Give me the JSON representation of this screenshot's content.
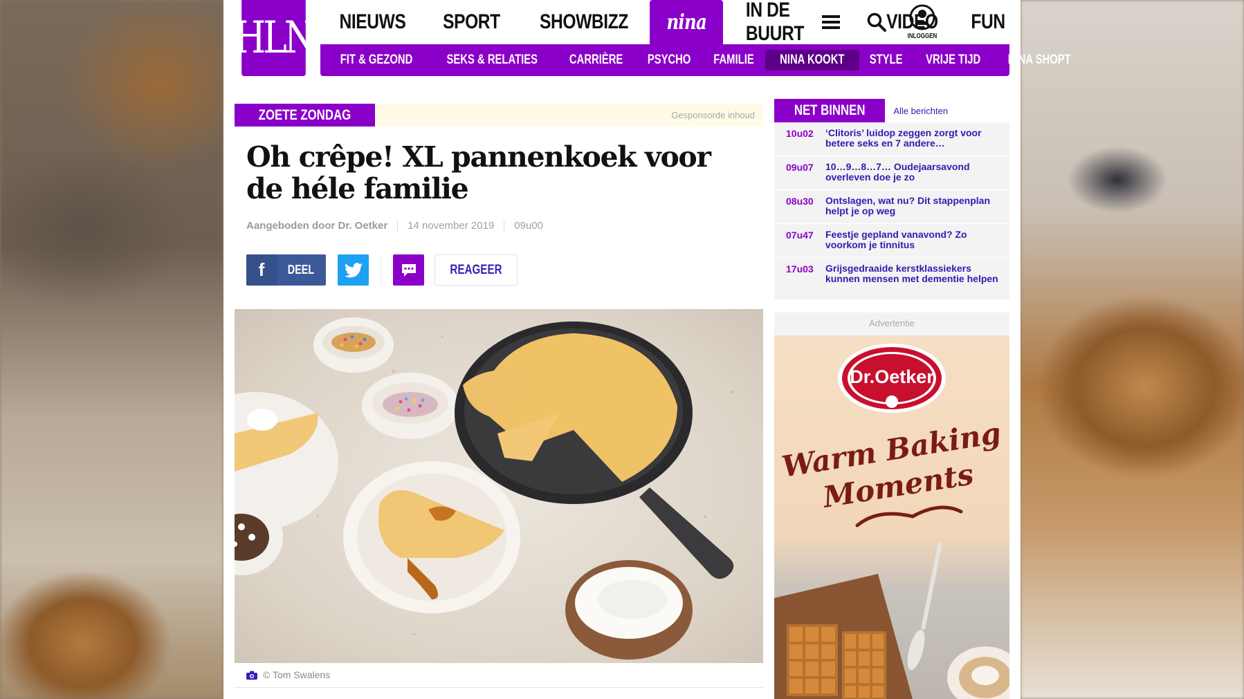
{
  "header": {
    "logo": "HLN",
    "main_nav": [
      {
        "label": "NIEUWS"
      },
      {
        "label": "SPORT"
      },
      {
        "label": "SHOWBIZZ"
      },
      {
        "label": "nina",
        "active": true
      },
      {
        "label": "IN DE BUURT"
      },
      {
        "label": "VIDEO"
      },
      {
        "label": "FUN"
      }
    ],
    "menu_icon": "hamburger-icon",
    "search_icon": "search-icon",
    "login_label": "INLOGGEN",
    "sub_nav": [
      {
        "label": "FIT & GEZOND"
      },
      {
        "label": "SEKS & RELATIES"
      },
      {
        "label": "CARRIÈRE"
      },
      {
        "label": "PSYCHO"
      },
      {
        "label": "FAMILIE"
      },
      {
        "label": "NINA KOOKT",
        "active": true
      },
      {
        "label": "STYLE"
      },
      {
        "label": "VRIJE TIJD"
      },
      {
        "label": "NINA SHOPT"
      }
    ]
  },
  "article": {
    "kicker": "ZOETE ZONDAG",
    "sponsored_label": "Gesponsorde inhoud",
    "headline": "Oh crêpe! XL pannenkoek voor de héle familie",
    "author": "Aangeboden door Dr. Oetker",
    "date": "14 november 2019",
    "time": "09u00",
    "share_facebook": "DEEL",
    "comment_label": "REAGEER",
    "photo_credit": "© Tom Swalens"
  },
  "sidebar": {
    "net_binnen_label": "NET BINNEN",
    "all_link": "Alle berichten",
    "items": [
      {
        "time": "10u02",
        "title": "‘Clitoris’ luidop zeggen zorgt voor betere seks en 7 andere…"
      },
      {
        "time": "09u07",
        "title": "10…9…8…7… Oudejaarsavond overleven doe je zo"
      },
      {
        "time": "08u30",
        "title": "Ontslagen, wat nu? Dit stappenplan helpt je op weg"
      },
      {
        "time": "07u47",
        "title": "Feestje gepland vanavond? Zo voorkom je tinnitus"
      },
      {
        "time": "17u03",
        "title": "Grijsgedraaide kerstklassiekers kunnen mensen met dementie helpen"
      }
    ],
    "ad_label": "Advertentie",
    "ad_brand": "Dr.Oetker",
    "ad_slogan_1": "Warm Baking",
    "ad_slogan_2": "Moments"
  },
  "colors": {
    "brand_purple": "#8b00c8",
    "link_blue": "#2f1bb0",
    "facebook": "#3b5998",
    "twitter": "#1da1f2"
  }
}
